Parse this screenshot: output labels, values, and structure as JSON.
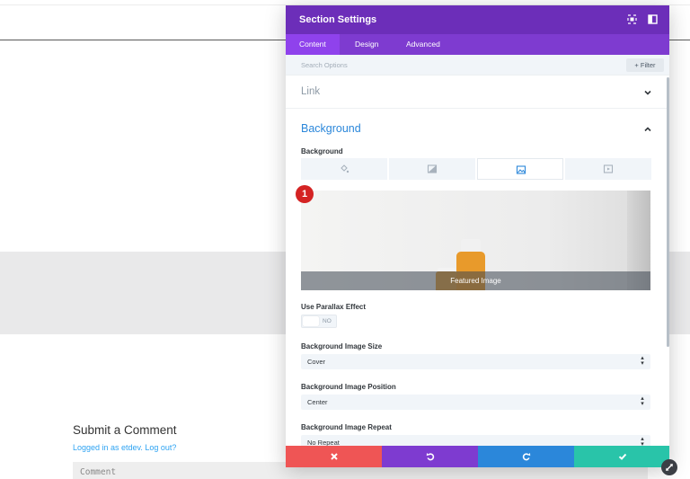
{
  "panel": {
    "title": "Section Settings",
    "header_icons": [
      "expand-icon",
      "split-view-icon"
    ],
    "tabs": [
      {
        "label": "Content",
        "active": true
      },
      {
        "label": "Design",
        "active": false
      },
      {
        "label": "Advanced",
        "active": false
      }
    ],
    "search": {
      "placeholder": "Search Options",
      "filter_label": "+ Filter"
    },
    "link_section": {
      "title": "Link",
      "collapsed": true
    },
    "background_section": {
      "title": "Background",
      "field_label": "Background",
      "bg_type_tabs": [
        "color-fill-icon",
        "gradient-icon",
        "image-icon",
        "video-icon"
      ],
      "active_bg_type": 2,
      "image_caption": "Featured Image",
      "badge_number": "1"
    },
    "parallax": {
      "label": "Use Parallax Effect",
      "value": "NO"
    },
    "image_size": {
      "label": "Background Image Size",
      "value": "Cover"
    },
    "image_position": {
      "label": "Background Image Position",
      "value": "Center"
    },
    "image_repeat": {
      "label": "Background Image Repeat",
      "value": "No Repeat"
    },
    "footer_buttons": [
      {
        "name": "discard",
        "color": "#ef5555"
      },
      {
        "name": "undo",
        "color": "#7e3bd0"
      },
      {
        "name": "redo",
        "color": "#2b87da"
      },
      {
        "name": "save",
        "color": "#29c4a9"
      }
    ]
  },
  "page": {
    "comment_title": "Submit a Comment",
    "comment_subtitle": "Logged in as etdev. Log out?",
    "comment_placeholder": "Comment"
  },
  "colors": {
    "header": "#6c2eb9",
    "tabs_bar": "#7e3bd0",
    "accent_blue": "#2b87da",
    "badge_red": "#d42323"
  }
}
